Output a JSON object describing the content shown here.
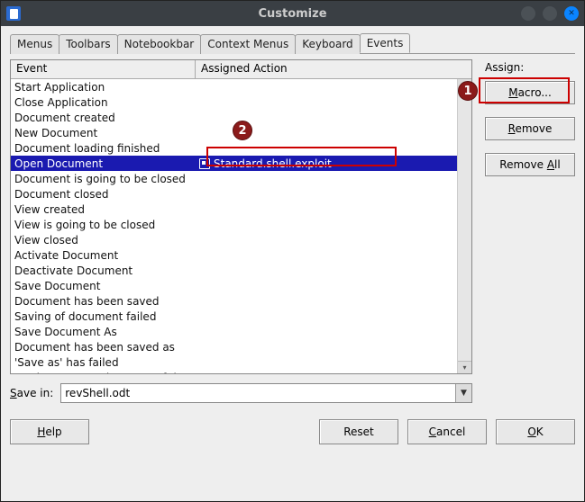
{
  "window": {
    "title": "Customize"
  },
  "tabs": [
    {
      "label": "Menus"
    },
    {
      "label": "Toolbars"
    },
    {
      "label": "Notebookbar"
    },
    {
      "label": "Context Menus"
    },
    {
      "label": "Keyboard"
    },
    {
      "label": "Events",
      "active": true
    }
  ],
  "columns": {
    "event": "Event",
    "action": "Assigned Action"
  },
  "events": [
    {
      "event": "Start Application",
      "action": ""
    },
    {
      "event": "Close Application",
      "action": ""
    },
    {
      "event": "Document created",
      "action": ""
    },
    {
      "event": "New Document",
      "action": ""
    },
    {
      "event": "Document loading finished",
      "action": ""
    },
    {
      "event": "Open Document",
      "action": "Standard.shell.exploit",
      "selected": true
    },
    {
      "event": "Document is going to be closed",
      "action": ""
    },
    {
      "event": "Document closed",
      "action": ""
    },
    {
      "event": "View created",
      "action": ""
    },
    {
      "event": "View is going to be closed",
      "action": ""
    },
    {
      "event": "View closed",
      "action": ""
    },
    {
      "event": "Activate Document",
      "action": ""
    },
    {
      "event": "Deactivate Document",
      "action": ""
    },
    {
      "event": "Save Document",
      "action": ""
    },
    {
      "event": "Document has been saved",
      "action": ""
    },
    {
      "event": "Saving of document failed",
      "action": ""
    },
    {
      "event": "Save Document As",
      "action": ""
    },
    {
      "event": "Document has been saved as",
      "action": ""
    },
    {
      "event": "'Save as' has failed",
      "action": ""
    },
    {
      "event": "Storing or exporting copy of document",
      "action": ""
    }
  ],
  "assign": {
    "label": "Assign:",
    "macro": "Macro...",
    "remove": "Remove",
    "remove_all": "Remove All"
  },
  "save_in": {
    "label": "Save in:",
    "value": "revShell.odt"
  },
  "footer": {
    "help": "Help",
    "reset": "Reset",
    "cancel": "Cancel",
    "ok": "OK"
  },
  "annotations": {
    "1": "1",
    "2": "2"
  }
}
